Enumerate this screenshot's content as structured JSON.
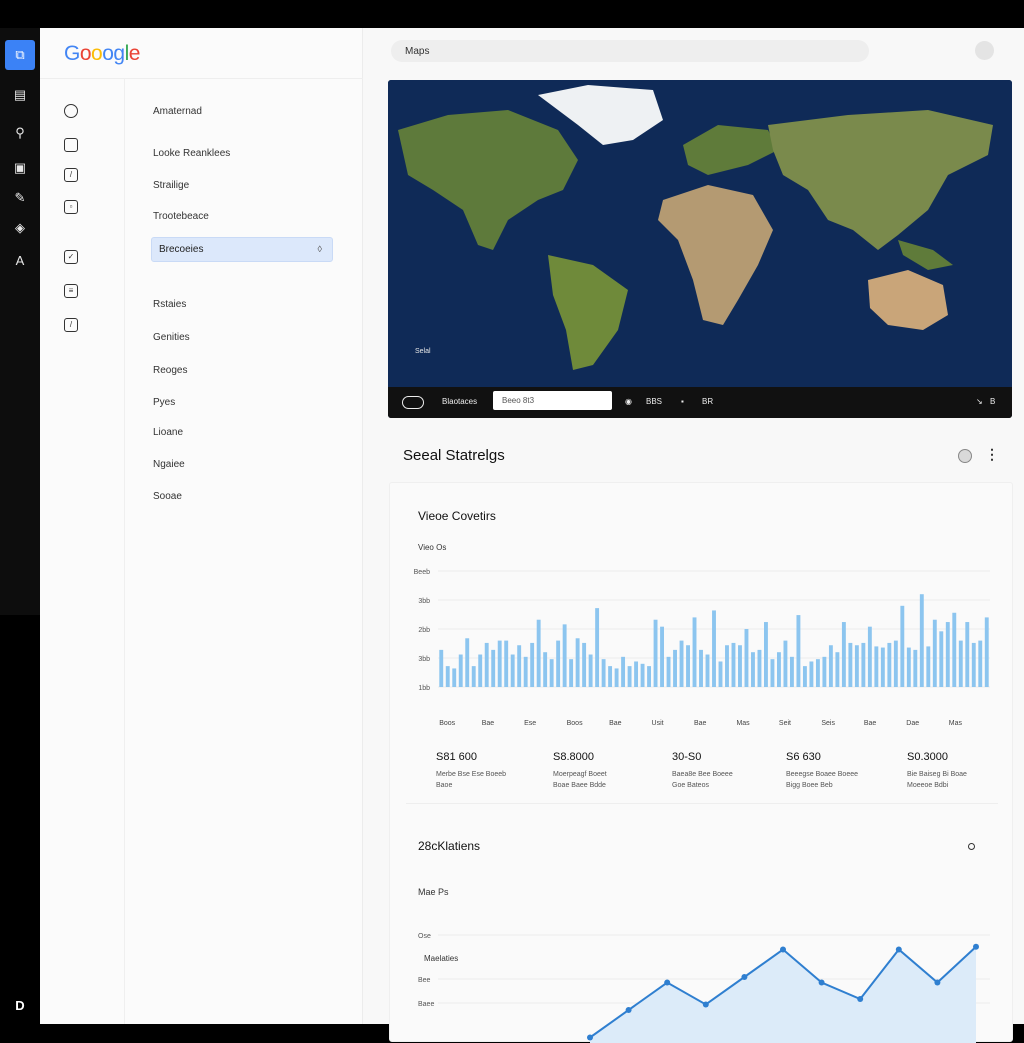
{
  "app": {
    "logo": "Google"
  },
  "search": {
    "value": "Maps"
  },
  "rail": {
    "icons": [
      "map-icon",
      "layers-icon",
      "pin-icon",
      "image-icon",
      "pen-icon",
      "cube-icon",
      "text-icon"
    ],
    "bottom_label": "D"
  },
  "sidebar": {
    "items": [
      {
        "label": "Amaternad"
      },
      {
        "label": "Looke Reanklees"
      },
      {
        "label": "Strailige"
      },
      {
        "label": "Trootebeace"
      },
      {
        "label": "Brecoeies"
      },
      {
        "label": "Rstaies"
      },
      {
        "label": "Genities"
      },
      {
        "label": "Reoges"
      },
      {
        "label": "Pyes"
      },
      {
        "label": "Lioane"
      },
      {
        "label": "Ngaiee"
      },
      {
        "label": "Sooae"
      }
    ]
  },
  "map": {
    "note": "Selal",
    "toolbar": {
      "left_label": "Blaotaces",
      "input_value": "Beeo 8t3",
      "item1": "BBS",
      "item2": "BR",
      "item3": "B"
    }
  },
  "section": {
    "title": "Seeal Statrelgs"
  },
  "card": {
    "title": "Vieoe Covetirs",
    "subtitle": "Vieo Os",
    "y_ticks": [
      "Beeb",
      "3bb",
      "2bb",
      "3bb",
      "1bb"
    ],
    "x_labels": [
      "Boos",
      "Bae",
      "Ese",
      "Boos",
      "Bae",
      "Usit",
      "Bae",
      "Mas",
      "Seit",
      "Seis",
      "Bae",
      "Dae",
      "Mas"
    ],
    "stats": [
      {
        "value": "S81 600",
        "desc1": "Merbe Bse Ese Boeeb",
        "desc2": "Baoe"
      },
      {
        "value": "S8.8000",
        "desc1": "Moerpeagf Boeet",
        "desc2": "Boae Baee Bdde"
      },
      {
        "value": "30-S0",
        "desc1": "Baea8e Bee Boeee",
        "desc2": "Goe Bateos"
      },
      {
        "value": "S6 630",
        "desc1": "Beeegse Boaee Boeee",
        "desc2": "Bigg Boee Beb"
      },
      {
        "value": "S0.3000",
        "desc1": "Bie Baiseg Bi Boae",
        "desc2": "Moeeoe Bdbi"
      }
    ]
  },
  "card2": {
    "title": "28cKlatiens",
    "subtitle": "Mae Ps",
    "y_ticks": [
      "Ose",
      "Bee",
      "Baee"
    ],
    "series_label": "Maelaties"
  },
  "chart_data": [
    {
      "type": "bar",
      "title": "Vieoe Covetirs",
      "categories": [
        "Boos",
        "Bae",
        "Ese",
        "Boos",
        "Bae",
        "Usit",
        "Bae",
        "Mas",
        "Seit",
        "Seis",
        "Bae",
        "Dae",
        "Mas"
      ],
      "values": [
        32,
        18,
        16,
        28,
        42,
        18,
        28,
        38,
        32,
        40,
        40,
        28,
        36,
        26,
        38,
        58,
        30,
        24,
        40,
        54,
        24,
        42,
        38,
        28,
        68,
        24,
        18,
        16,
        26,
        18,
        22,
        20,
        18,
        58,
        52,
        26,
        32,
        40,
        36,
        60,
        32,
        28,
        66,
        22,
        36,
        38,
        36,
        50,
        30,
        32,
        56,
        24,
        30,
        40,
        26,
        62,
        18,
        22,
        24,
        26,
        36,
        30,
        56,
        38,
        36,
        38,
        52,
        35,
        34,
        38,
        40,
        70,
        34,
        32,
        80,
        35,
        58,
        48,
        56,
        64,
        40,
        56,
        38,
        40,
        60
      ],
      "ylim": [
        0,
        100
      ]
    },
    {
      "type": "line",
      "title": "28cKlatiens",
      "x": [
        1,
        2,
        3,
        4,
        5,
        6,
        7,
        8,
        9,
        10,
        11
      ],
      "y": [
        2,
        12,
        22,
        14,
        24,
        34,
        22,
        16,
        34,
        22,
        35
      ],
      "ylim": [
        0,
        40
      ]
    }
  ]
}
